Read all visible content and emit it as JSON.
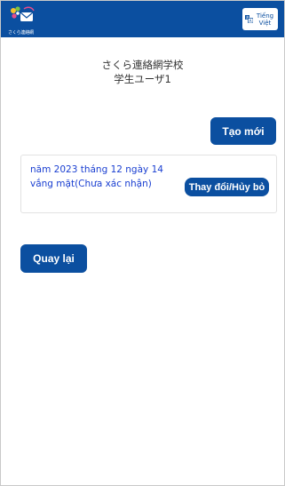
{
  "header": {
    "logo_text": "さくら連絡網",
    "language_button_label": "Tiếng Việt",
    "language_icon": "translate-icon",
    "logo_icon": "sakura-logo-icon",
    "background_color": "#0b4fa0"
  },
  "profile": {
    "school_name": "さくら連絡網学校",
    "user_name": "学生ユーザ1"
  },
  "actions": {
    "create_label": "Tạo mới",
    "back_label": "Quay lại"
  },
  "absence_entries": [
    {
      "date_text": "năm 2023 tháng 12 ngày 14",
      "status_text": "vắng mặt(Chưa xác nhận)",
      "change_label": "Thay đổi/Hủy bỏ"
    }
  ],
  "colors": {
    "primary": "#0b4fa0",
    "entry_text": "#1a3fd1",
    "text": "#333333"
  }
}
